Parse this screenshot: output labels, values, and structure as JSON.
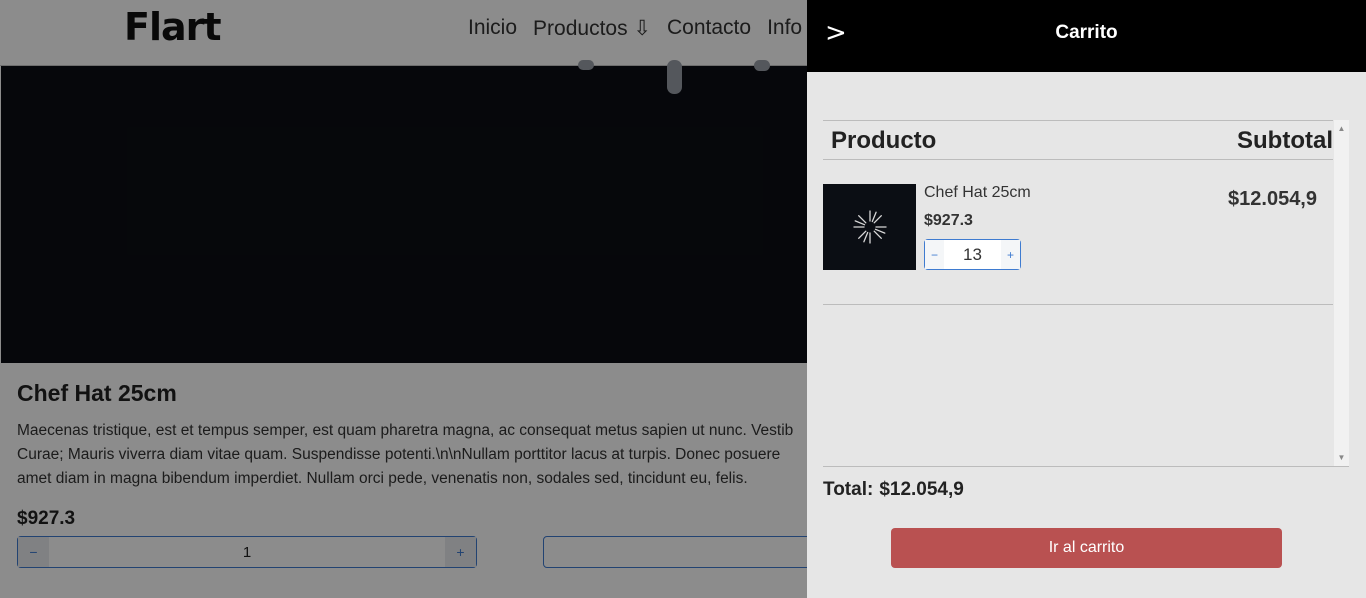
{
  "header": {
    "brand": "Flart",
    "nav": [
      {
        "label": "Inicio"
      },
      {
        "label": "Productos ⇩"
      },
      {
        "label": "Contacto"
      },
      {
        "label": "Info"
      }
    ]
  },
  "product": {
    "title": "Chef Hat 25cm",
    "description": "Maecenas tristique, est et tempus semper, est quam pharetra magna, ac consequat metus sapien ut nunc. Vestib\nCurae; Mauris viverra diam vitae quam. Suspendisse potenti.\\n\\nNullam porttitor lacus at turpis. Donec posuere\namet diam in magna bibendum imperdiet. Nullam orci pede, venenatis non, sodales sed, tincidunt eu, felis.",
    "price": "$927.3",
    "quantity": "1",
    "minus": "−",
    "plus": "+"
  },
  "cart": {
    "close_glyph": ">",
    "title": "Carrito",
    "col_product": "Producto",
    "col_subtotal": "Subtotal",
    "items": [
      {
        "name": "Chef Hat 25cm",
        "price": "$927.3",
        "quantity": "13",
        "minus": "−",
        "plus": "+",
        "subtotal": "$12.054,9"
      }
    ],
    "total_label": "Total:",
    "total_value": "$12.054,9",
    "go_button": "Ir al carrito"
  },
  "colors": {
    "drawer_bg": "#e6e6e6",
    "header_bg": "#000000",
    "button_bg": "#b95151",
    "accent": "#3e7bd0"
  }
}
